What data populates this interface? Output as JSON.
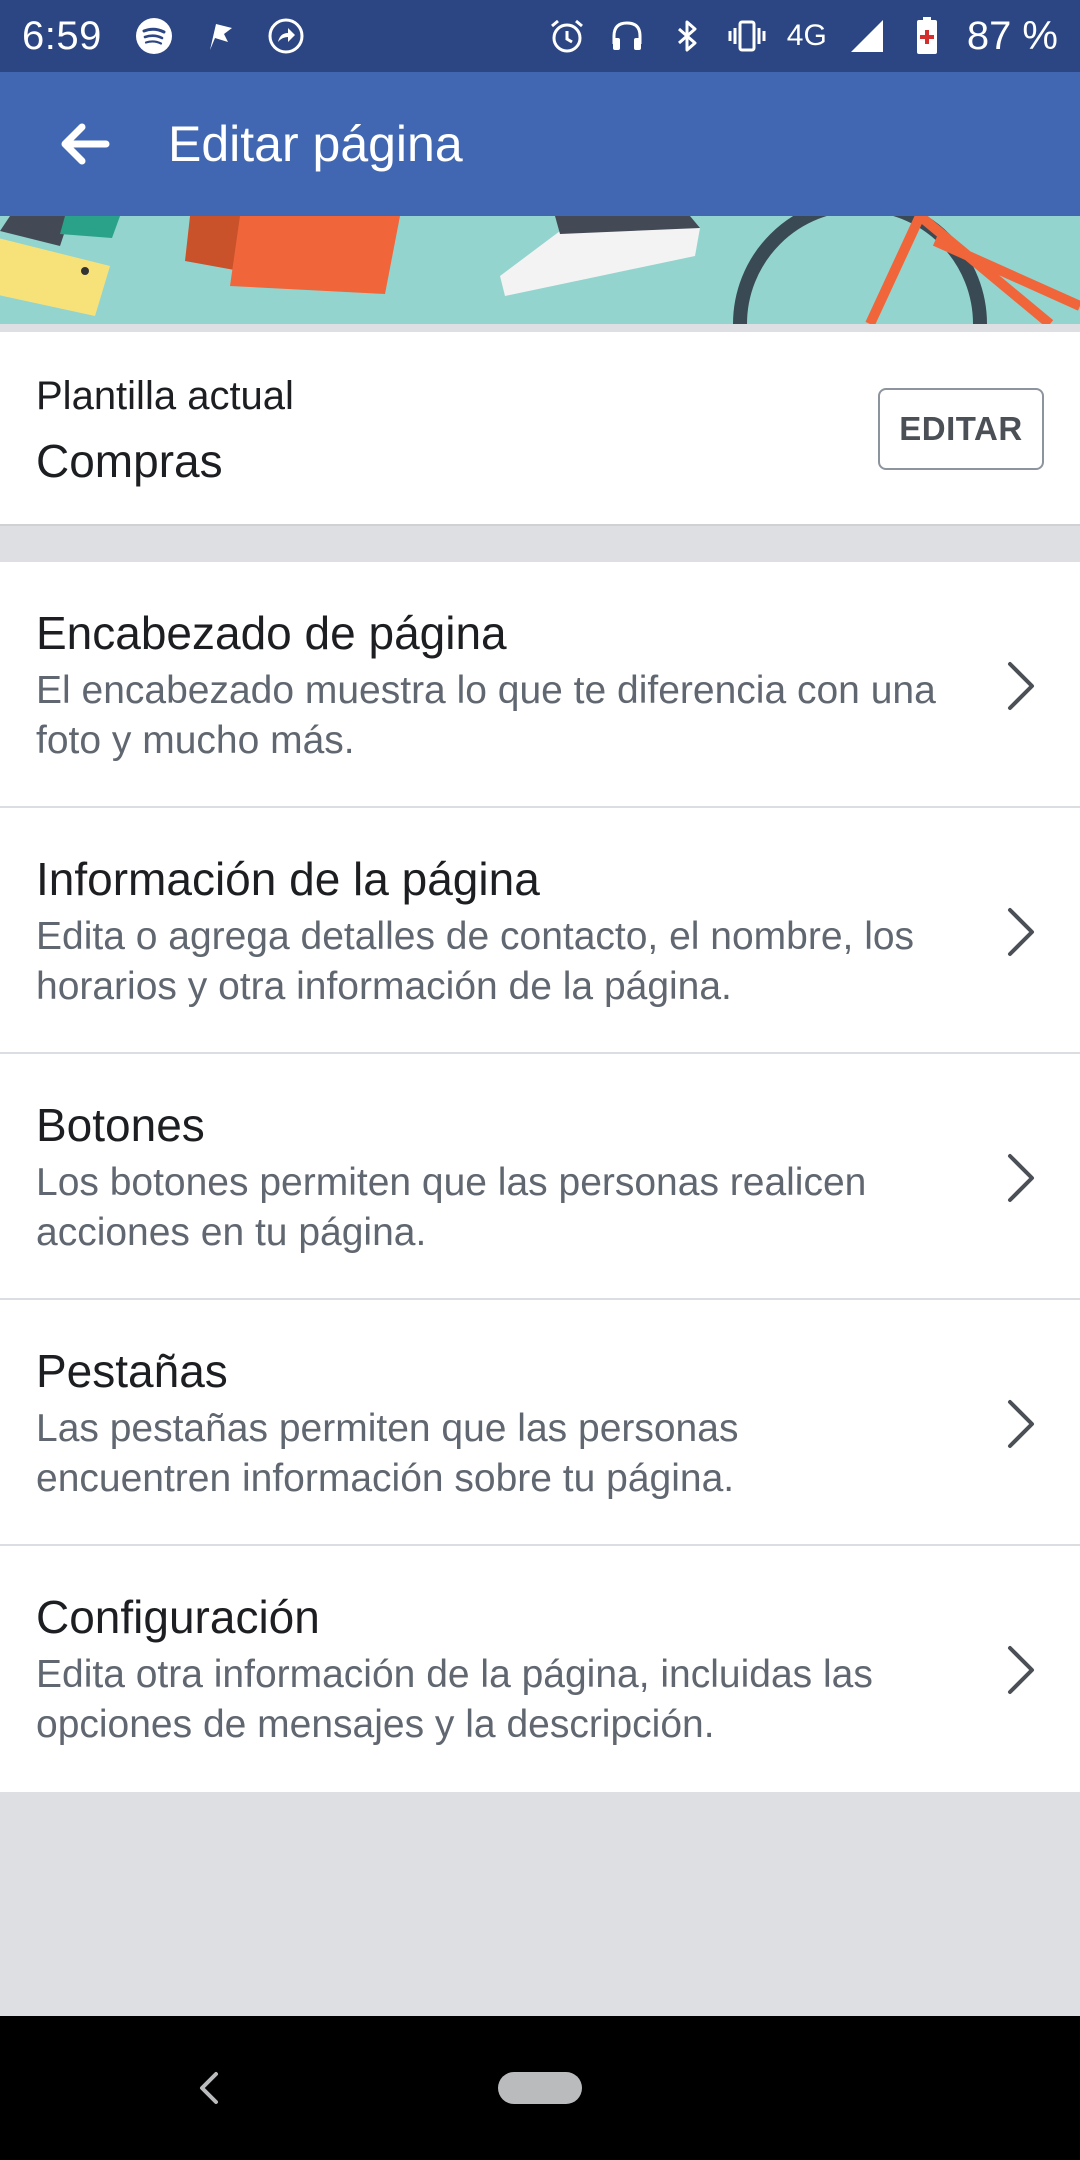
{
  "status_bar": {
    "time": "6:59",
    "network": "4G",
    "battery": "87 %",
    "icons": [
      "spotify-icon",
      "flag-icon",
      "share-icon",
      "alarm-icon",
      "headphones-icon",
      "bluetooth-icon",
      "vibrate-icon",
      "signal-icon",
      "battery-icon"
    ]
  },
  "app_bar": {
    "back_icon": "arrow-left-icon",
    "title": "Editar página"
  },
  "template": {
    "label": "Plantilla actual",
    "value": "Compras",
    "edit_label": "EDITAR"
  },
  "menu": {
    "items": [
      {
        "title": "Encabezado de página",
        "description": "El encabezado muestra lo que te diferencia con una foto y mucho más."
      },
      {
        "title": "Información de la página",
        "description": "Edita o agrega detalles de contacto, el nombre, los horarios y otra información de la página."
      },
      {
        "title": "Botones",
        "description": "Los botones permiten que las personas realicen acciones en tu página."
      },
      {
        "title": "Pestañas",
        "description": "Las pestañas permiten que las personas encuentren información sobre tu página."
      },
      {
        "title": "Configuración",
        "description": "Edita otra información de la página, incluidas las opciones de mensajes y la descripción."
      }
    ]
  },
  "colors": {
    "status_bar": "#2c4583",
    "app_bar": "#4267b2",
    "cover_bg": "#93d4cf",
    "page_bg": "#dddfe3"
  }
}
